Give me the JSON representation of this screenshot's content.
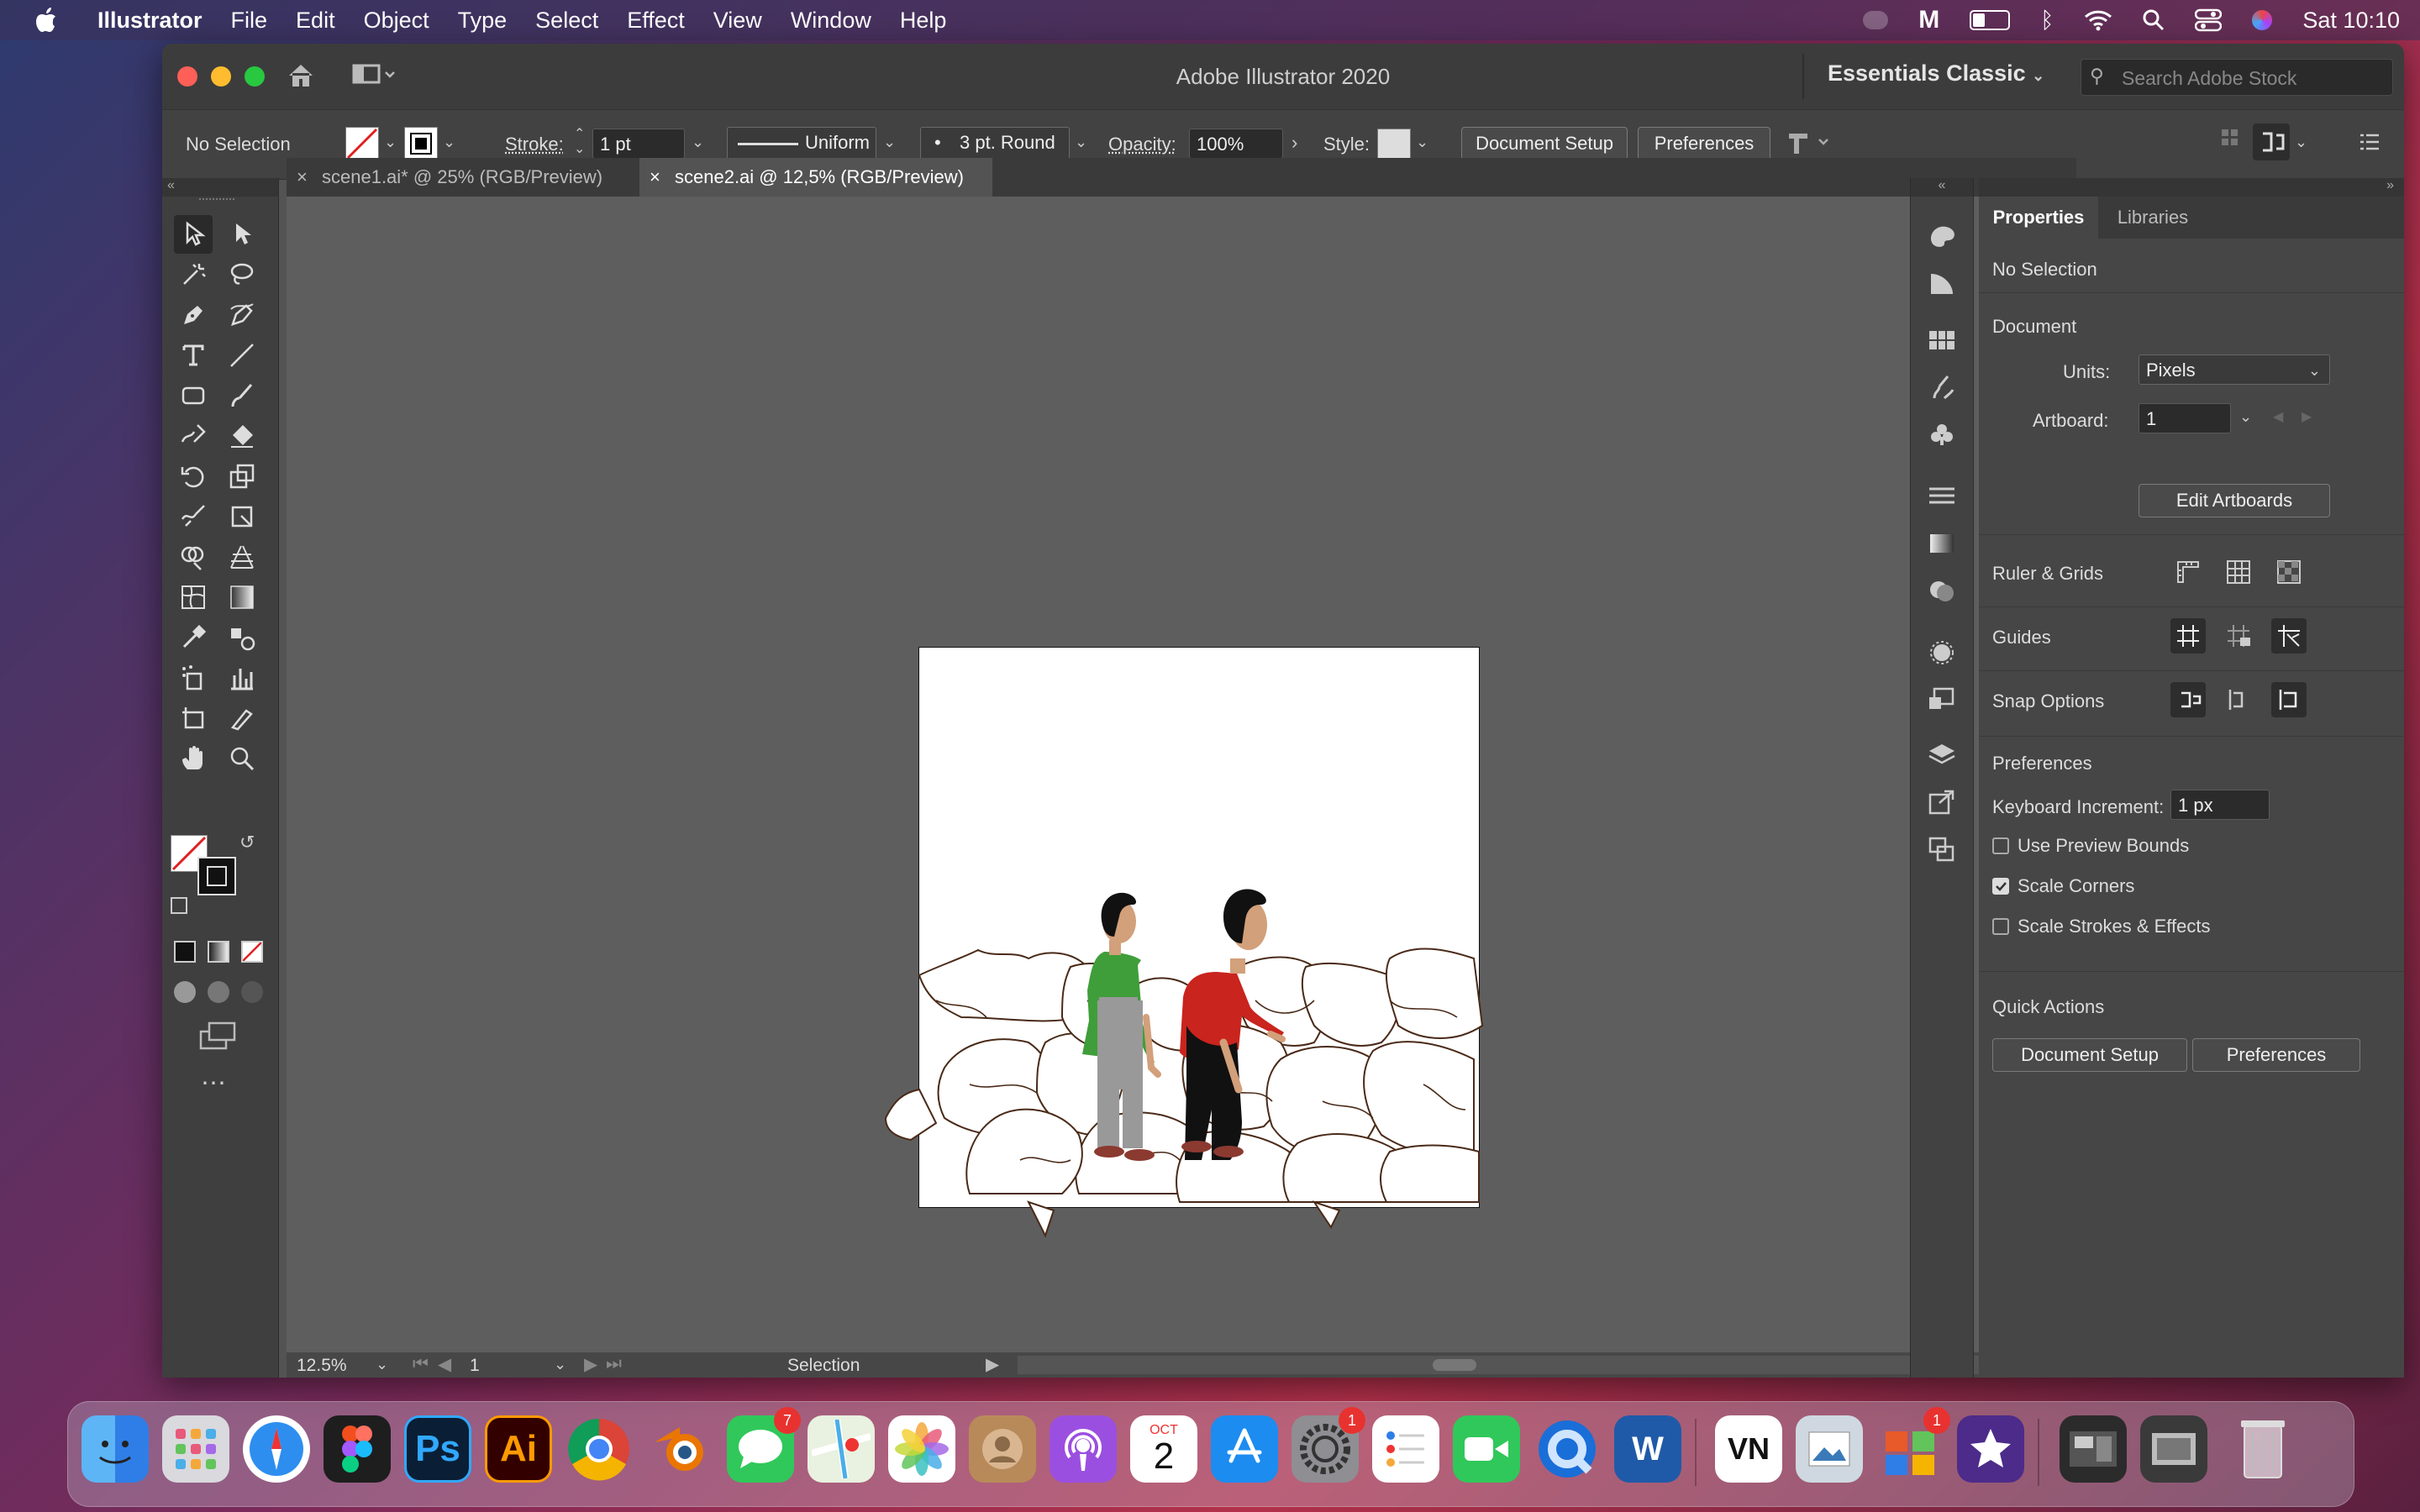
{
  "menubar": {
    "app": "Illustrator",
    "items": [
      "File",
      "Edit",
      "Object",
      "Type",
      "Select",
      "Effect",
      "View",
      "Window",
      "Help"
    ],
    "clock": "Sat 10:10"
  },
  "window": {
    "title": "Adobe Illustrator 2020",
    "workspace": "Essentials Classic",
    "search_placeholder": "Search Adobe Stock"
  },
  "control": {
    "selection": "No Selection",
    "stroke_label": "Stroke:",
    "stroke_value": "1 pt",
    "profile": "Uniform",
    "brush": "3 pt. Round",
    "opacity_label": "Opacity:",
    "opacity_value": "100%",
    "style_label": "Style:",
    "doc_setup": "Document Setup",
    "preferences": "Preferences"
  },
  "tabs": [
    {
      "label": "scene1.ai* @ 25% (RGB/Preview)",
      "active": false
    },
    {
      "label": "scene2.ai @ 12,5% (RGB/Preview)",
      "active": true
    }
  ],
  "status": {
    "zoom": "12.5%",
    "artboard": "1",
    "tool": "Selection"
  },
  "properties": {
    "tab_properties": "Properties",
    "tab_libraries": "Libraries",
    "no_selection": "No Selection",
    "document": "Document",
    "units_label": "Units:",
    "units_value": "Pixels",
    "artboard_label": "Artboard:",
    "artboard_value": "1",
    "edit_artboards": "Edit Artboards",
    "ruler_grids": "Ruler & Grids",
    "guides": "Guides",
    "snap_options": "Snap Options",
    "preferences": "Preferences",
    "keyboard_increment_label": "Keyboard Increment:",
    "keyboard_increment_value": "1 px",
    "use_preview_bounds": "Use Preview Bounds",
    "scale_corners": "Scale Corners",
    "scale_strokes": "Scale Strokes & Effects",
    "quick_actions": "Quick Actions",
    "qa_doc_setup": "Document Setup",
    "qa_preferences": "Preferences",
    "checks": {
      "use_preview_bounds": false,
      "scale_corners": true,
      "scale_strokes": false
    }
  },
  "dock": {
    "apps": [
      "Finder",
      "Launchpad",
      "Safari",
      "Figma",
      "Photoshop",
      "Illustrator",
      "Chrome",
      "Blender",
      "Messages",
      "Maps",
      "Photos",
      "Contacts",
      "Podcasts",
      "Calendar",
      "App Store",
      "System Preferences",
      "Reminders",
      "FaceTime",
      "QuickTime",
      "Word",
      "VN",
      "Preview",
      "Office",
      "iMovie",
      "Screenshots",
      "Downloads",
      "Trash"
    ],
    "ps_label": "Ps",
    "ai_label": "Ai",
    "word_label": "W",
    "vn_label": "VN",
    "calendar_month": "OCT",
    "calendar_day": "2",
    "messages_badge": "7",
    "sysprefs_badge": "1",
    "office_badge": "1"
  },
  "colors": {
    "accent": "#2d6fd6",
    "shirt_green": "#3f9e3a",
    "shirt_red": "#c9241d"
  }
}
